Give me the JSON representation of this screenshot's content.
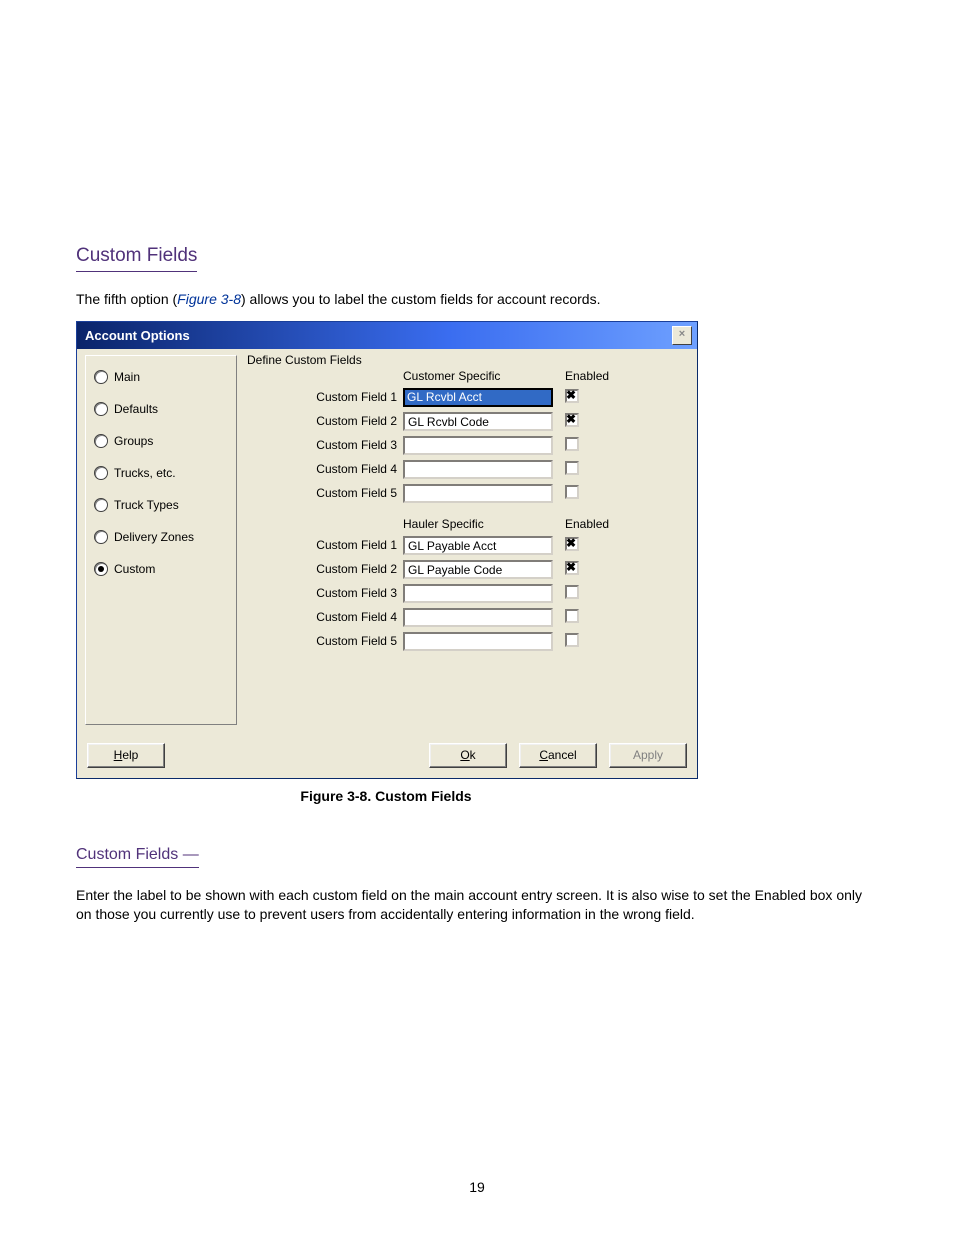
{
  "section_title": "Custom Fields",
  "intro_1_pre": "The fifth option (",
  "intro_1_fig": "Figure 3-8",
  "intro_1_post": ") allows you to label the custom fields for account records.",
  "figure_ref": "Figure 3-8. Custom Fields",
  "dialog": {
    "title": "Account Options",
    "nav": [
      {
        "label": "Main",
        "selected": false
      },
      {
        "label": "Defaults",
        "selected": false
      },
      {
        "label": "Groups",
        "selected": false
      },
      {
        "label": "Trucks, etc.",
        "selected": false
      },
      {
        "label": "Truck Types",
        "selected": false
      },
      {
        "label": "Delivery Zones",
        "selected": false
      },
      {
        "label": "Custom",
        "selected": true
      }
    ],
    "groupbox_label": "Define Custom Fields",
    "sections": [
      {
        "header_value": "Customer Specific",
        "header_enabled": "Enabled",
        "rows": [
          {
            "label": "Custom Field 1",
            "value": "GL Rcvbl Acct",
            "enabled": true,
            "selected": true
          },
          {
            "label": "Custom Field 2",
            "value": "GL Rcvbl Code",
            "enabled": true,
            "selected": false
          },
          {
            "label": "Custom Field 3",
            "value": "",
            "enabled": false,
            "selected": false
          },
          {
            "label": "Custom Field 4",
            "value": "",
            "enabled": false,
            "selected": false
          },
          {
            "label": "Custom Field 5",
            "value": "",
            "enabled": false,
            "selected": false
          }
        ]
      },
      {
        "header_value": "Hauler Specific",
        "header_enabled": "Enabled",
        "rows": [
          {
            "label": "Custom Field 1",
            "value": "GL Payable Acct",
            "enabled": true,
            "selected": false
          },
          {
            "label": "Custom Field 2",
            "value": "GL Payable Code",
            "enabled": true,
            "selected": false
          },
          {
            "label": "Custom Field 3",
            "value": "",
            "enabled": false,
            "selected": false
          },
          {
            "label": "Custom Field 4",
            "value": "",
            "enabled": false,
            "selected": false
          },
          {
            "label": "Custom Field 5",
            "value": "",
            "enabled": false,
            "selected": false
          }
        ]
      }
    ],
    "buttons": {
      "help": "Help",
      "ok": "Ok",
      "cancel": "Cancel",
      "apply": "Apply"
    }
  },
  "subtitle": "Custom Fields —",
  "trailing_text": "Enter the label to be shown with each custom field on the main account entry screen. It is also wise to set the Enabled box only on those you currently use to prevent users from accidentally entering information in the wrong field.",
  "page_number": "19"
}
